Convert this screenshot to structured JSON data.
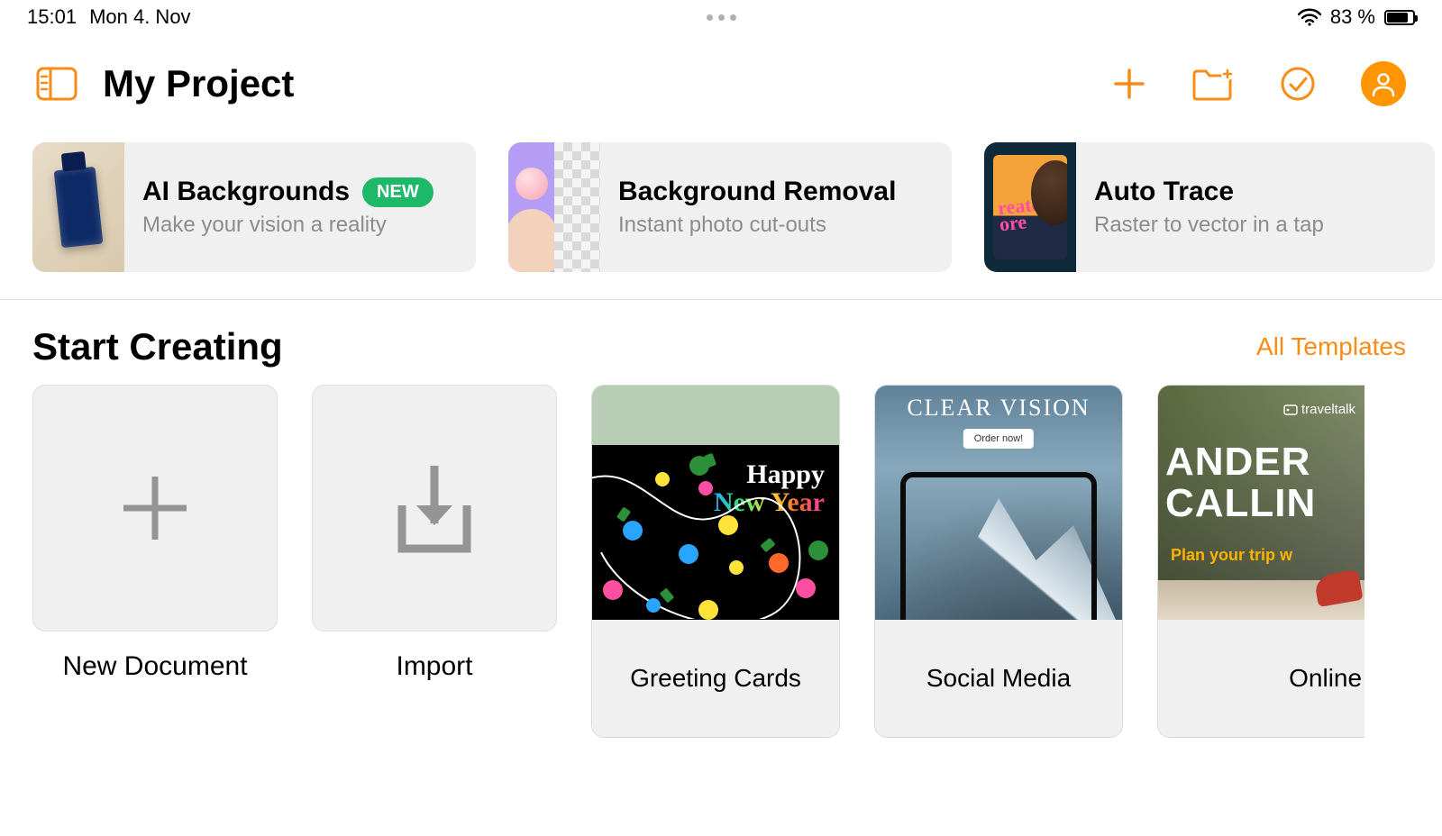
{
  "status": {
    "time": "15:01",
    "date": "Mon 4. Nov",
    "battery_text": "83 %",
    "battery_level": 83
  },
  "header": {
    "title": "My Project"
  },
  "features": [
    {
      "title": "AI Backgrounds",
      "subtitle": "Make your vision a reality",
      "badge": "NEW"
    },
    {
      "title": "Background Removal",
      "subtitle": "Instant photo cut-outs"
    },
    {
      "title": "Auto Trace",
      "subtitle": "Raster to vector in a tap"
    }
  ],
  "start_section": {
    "heading": "Start Creating",
    "link": "All Templates"
  },
  "actions": {
    "new_document": "New Document",
    "import": "Import"
  },
  "templates": [
    {
      "label": "Greeting Cards",
      "art": {
        "line1": "Happy",
        "line2": "New Year"
      }
    },
    {
      "label": "Social Media",
      "art": {
        "headline": "CLEAR VISION",
        "cta": "Order now!"
      }
    },
    {
      "label": "Online Ads",
      "art": {
        "logo": "traveltalk",
        "head1": "ANDER",
        "head2": "CALLIN",
        "sub": "Plan your trip w"
      }
    }
  ]
}
